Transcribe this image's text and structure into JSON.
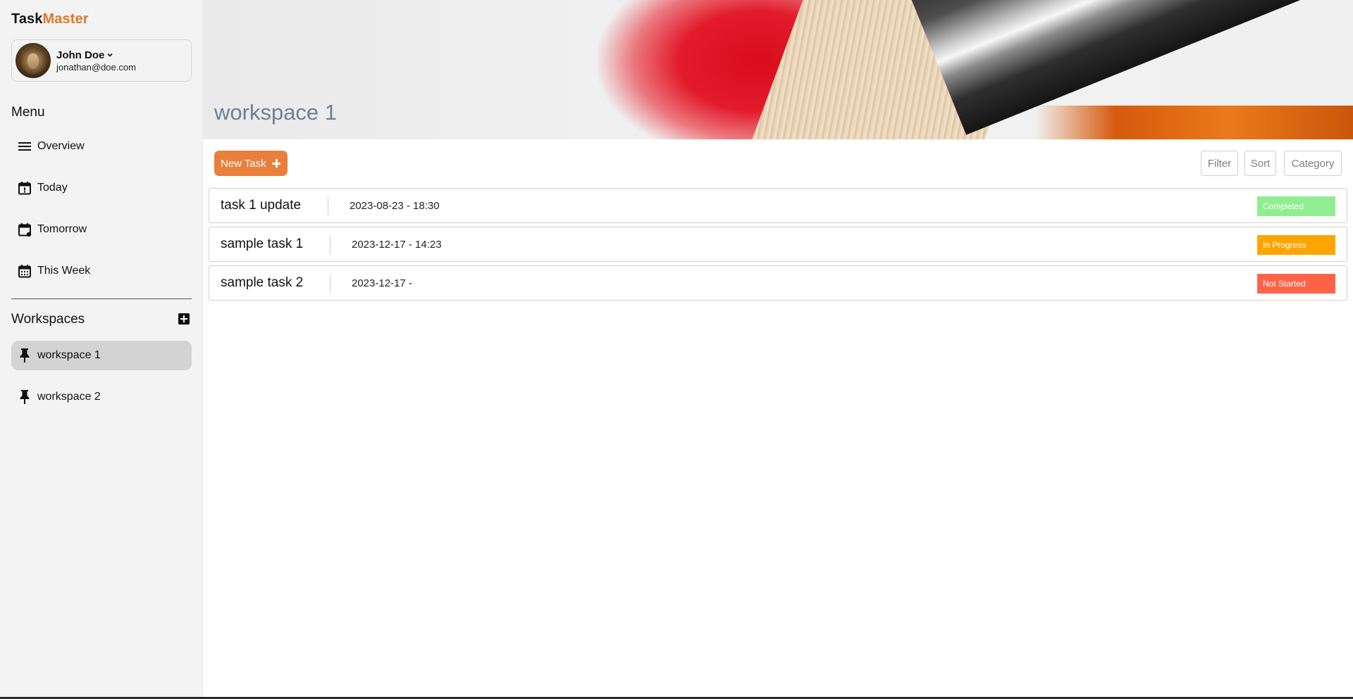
{
  "brand": {
    "part1": "Task",
    "part2": "Master",
    "accent_color": "#e0762a"
  },
  "user": {
    "name": "John Doe",
    "email": "jonathan@doe.com",
    "avatar_icon": "lion-avatar"
  },
  "menu": {
    "title": "Menu",
    "items": [
      {
        "label": "Overview",
        "icon": "menu-lines-icon"
      },
      {
        "label": "Today",
        "icon": "calendar-today-icon"
      },
      {
        "label": "Tomorrow",
        "icon": "calendar-tomorrow-icon"
      },
      {
        "label": "This Week",
        "icon": "calendar-week-icon"
      }
    ]
  },
  "workspaces": {
    "title": "Workspaces",
    "add_icon": "add-square-icon",
    "items": [
      {
        "label": "workspace 1",
        "icon": "pin-icon",
        "active": true
      },
      {
        "label": "workspace 2",
        "icon": "pin-icon",
        "active": false
      }
    ]
  },
  "header": {
    "title": "workspace 1"
  },
  "toolbar": {
    "new_task_label": "New Task",
    "filter_label": "Filter",
    "sort_label": "Sort",
    "category_label": "Category",
    "new_task_color": "#e87f3c"
  },
  "tasks": [
    {
      "name": "task 1 update",
      "date": "2023-08-23 - 18:30",
      "status": "Completed",
      "status_color": "#90ee90"
    },
    {
      "name": "sample task 1",
      "date": "2023-12-17 - 14:23",
      "status": "In Progress",
      "status_color": "#ffa500"
    },
    {
      "name": "sample task 2",
      "date": "2023-12-17 -",
      "status": "Not Started",
      "status_color": "#ff6347"
    }
  ]
}
